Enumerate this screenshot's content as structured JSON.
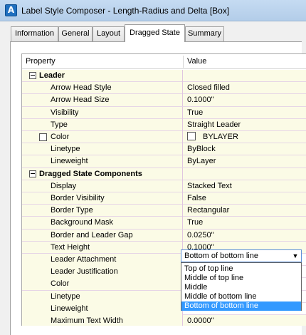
{
  "window": {
    "title": "Label Style Composer - Length-Radius and Delta [Box]",
    "app_icon": "autocad-icon",
    "app_icon_letter": "A"
  },
  "tabs": [
    {
      "label": "Information"
    },
    {
      "label": "General"
    },
    {
      "label": "Layout"
    },
    {
      "label": "Dragged State"
    },
    {
      "label": "Summary"
    }
  ],
  "active_tab": "Dragged State",
  "grid": {
    "col_property": "Property",
    "col_value": "Value",
    "leader": {
      "label": "Leader",
      "rows": [
        {
          "name": "Arrow Head Style",
          "value": "Closed filled"
        },
        {
          "name": "Arrow Head Size",
          "value": "0.1000\""
        },
        {
          "name": "Visibility",
          "value": "True"
        },
        {
          "name": "Type",
          "value": "Straight Leader"
        },
        {
          "name": "Color",
          "value": "BYLAYER"
        },
        {
          "name": "Linetype",
          "value": "ByBlock"
        },
        {
          "name": "Lineweight",
          "value": "ByLayer"
        }
      ]
    },
    "dragged": {
      "label": "Dragged State Components",
      "rows": [
        {
          "name": "Display",
          "value": "Stacked Text"
        },
        {
          "name": "Border Visibility",
          "value": "False"
        },
        {
          "name": "Border Type",
          "value": "Rectangular"
        },
        {
          "name": "Background Mask",
          "value": "True"
        },
        {
          "name": "Border and Leader Gap",
          "value": "0.0250\""
        },
        {
          "name": "Text Height",
          "value": "0.1000\""
        },
        {
          "name": "Leader Attachment",
          "value": "Bottom of bottom line"
        },
        {
          "name": "Leader Justification",
          "value": ""
        },
        {
          "name": "Color",
          "value": ""
        },
        {
          "name": "Linetype",
          "value": ""
        },
        {
          "name": "Lineweight",
          "value": ""
        },
        {
          "name": "Maximum Text Width",
          "value": "0.0000\""
        }
      ]
    }
  },
  "combo": {
    "selected": "Bottom of bottom line",
    "options": [
      "Top of top line",
      "Middle of top line",
      "Middle",
      "Middle of bottom line",
      "Bottom of bottom line"
    ]
  },
  "colors": {
    "row_bg": "#fbfbe6",
    "selection": "#3399ff",
    "titlebar": "#c5dbf2"
  }
}
